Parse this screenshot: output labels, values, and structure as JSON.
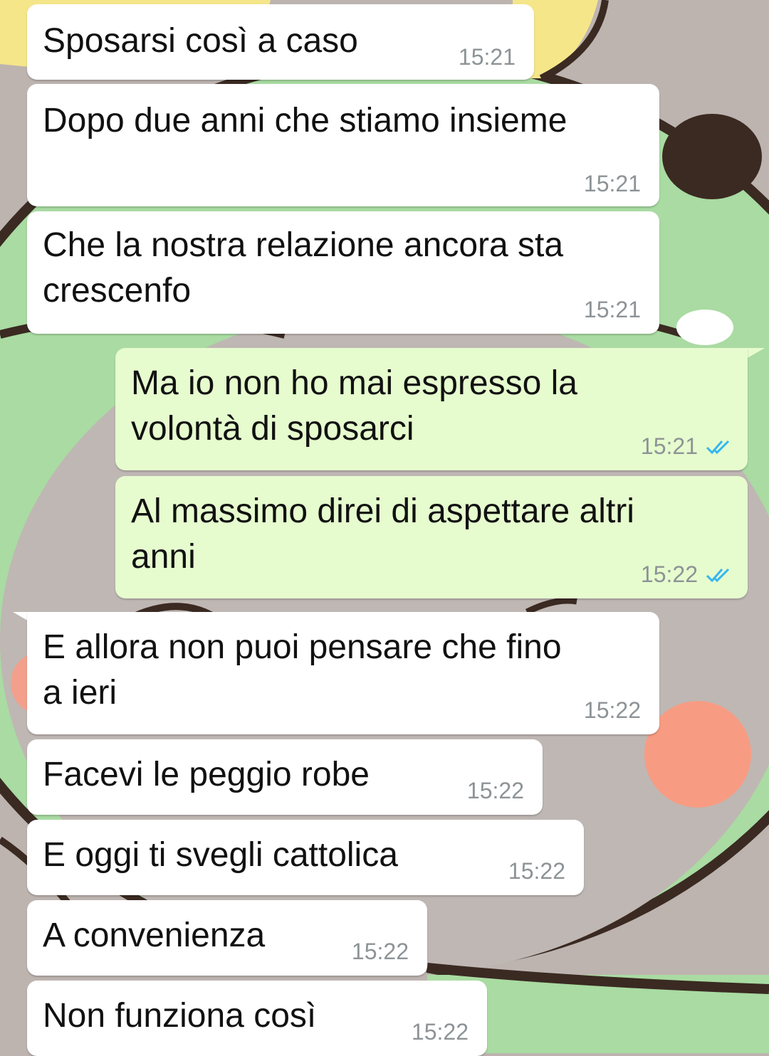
{
  "messages": [
    {
      "dir": "in",
      "text": "Sposarsi così a caso",
      "time": "15:21"
    },
    {
      "dir": "in",
      "text": "Dopo due anni che stiamo insieme",
      "time": "15:21"
    },
    {
      "dir": "in",
      "text": "Che la nostra relazione ancora sta\ncrescenfo",
      "time": "15:21"
    },
    {
      "dir": "out",
      "text": "Ma io non ho mai espresso la\nvolontà di sposarci",
      "time": "15:21",
      "status": "read"
    },
    {
      "dir": "out",
      "text": "Al massimo direi di aspettare altri\nanni",
      "time": "15:22",
      "status": "read"
    },
    {
      "dir": "in",
      "text": "E allora non puoi pensare che fino\na ieri",
      "time": "15:22"
    },
    {
      "dir": "in",
      "text": "Facevi le peggio robe",
      "time": "15:22"
    },
    {
      "dir": "in",
      "text": "E oggi ti svegli cattolica",
      "time": "15:22"
    },
    {
      "dir": "in",
      "text": "A convenienza",
      "time": "15:22"
    },
    {
      "dir": "in",
      "text": "Non funziona così",
      "time": "15:22"
    }
  ],
  "colors": {
    "incoming_bubble": "#ffffff",
    "outgoing_bubble": "#e6fcce",
    "timestamp": "#8d9396",
    "read_ticks": "#34b7f1"
  },
  "icons": {
    "read_status": "double-check-icon"
  }
}
